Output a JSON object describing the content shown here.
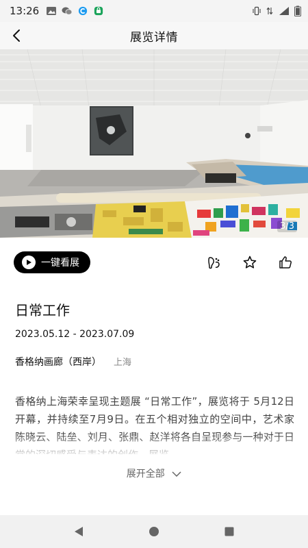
{
  "status_bar": {
    "time": "13:26",
    "battery_level": 0.9
  },
  "header": {
    "title": "展览详情"
  },
  "hero": {
    "image_subject": "gallery interior with prints on display tables",
    "page_indicator": "3/3"
  },
  "actions": {
    "tour_label": "一键看展",
    "icons": [
      "footprints-icon",
      "star-icon",
      "thumbs-up-icon"
    ]
  },
  "exhibition": {
    "title": "日常工作",
    "dates": "2023.05.12 - 2023.07.09",
    "venue": "香格纳画廊（西岸）",
    "city": "上海",
    "description": "香格纳上海荣幸呈现主题展 “日常工作”，展览将于 5月12日开幕，并持续至7月9日。在五个相对独立的空间中，艺术家陈晓云、陆垒、刘月、张鼎、赵洋将各自呈现参与一种对于日常的深切感受与表达的创作，展览"
  },
  "expand": {
    "label": "展开全部"
  },
  "colors": {
    "accent": "#000000",
    "background": "#ffffff",
    "muted_text": "#888888"
  }
}
